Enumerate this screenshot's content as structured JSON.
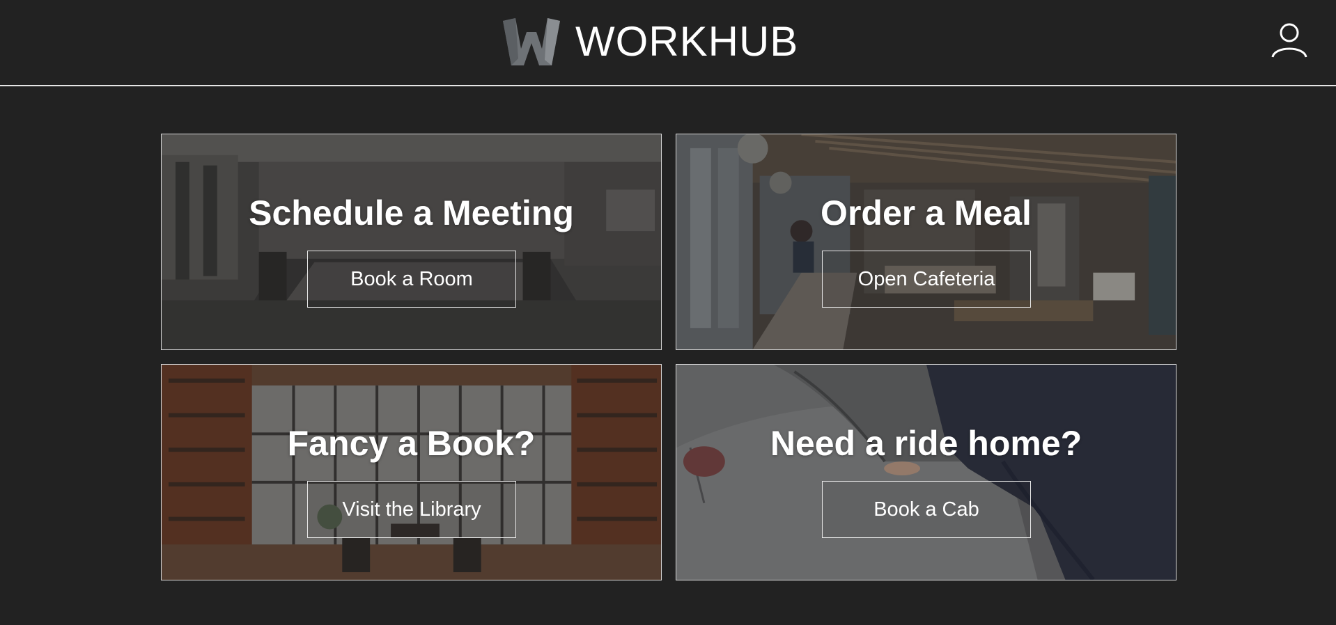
{
  "header": {
    "brand_name": "WORKHUB",
    "logo_icon": "workhub-w-logo",
    "user_icon": "user-profile-icon"
  },
  "colors": {
    "background": "#222222",
    "text": "#ffffff",
    "border": "#d9d9d9"
  },
  "cards": [
    {
      "id": "meeting",
      "title": "Schedule a Meeting",
      "button_label": "Book a Room",
      "image": "conference-room-photo"
    },
    {
      "id": "meal",
      "title": "Order a Meal",
      "button_label": "Open Cafeteria",
      "image": "office-cafeteria-photo"
    },
    {
      "id": "book",
      "title": "Fancy a Book?",
      "button_label": "Visit the Library",
      "image": "library-bookshelves-photo"
    },
    {
      "id": "ride",
      "title": "Need a ride home?",
      "button_label": "Book a Cab",
      "image": "car-door-photo"
    }
  ]
}
